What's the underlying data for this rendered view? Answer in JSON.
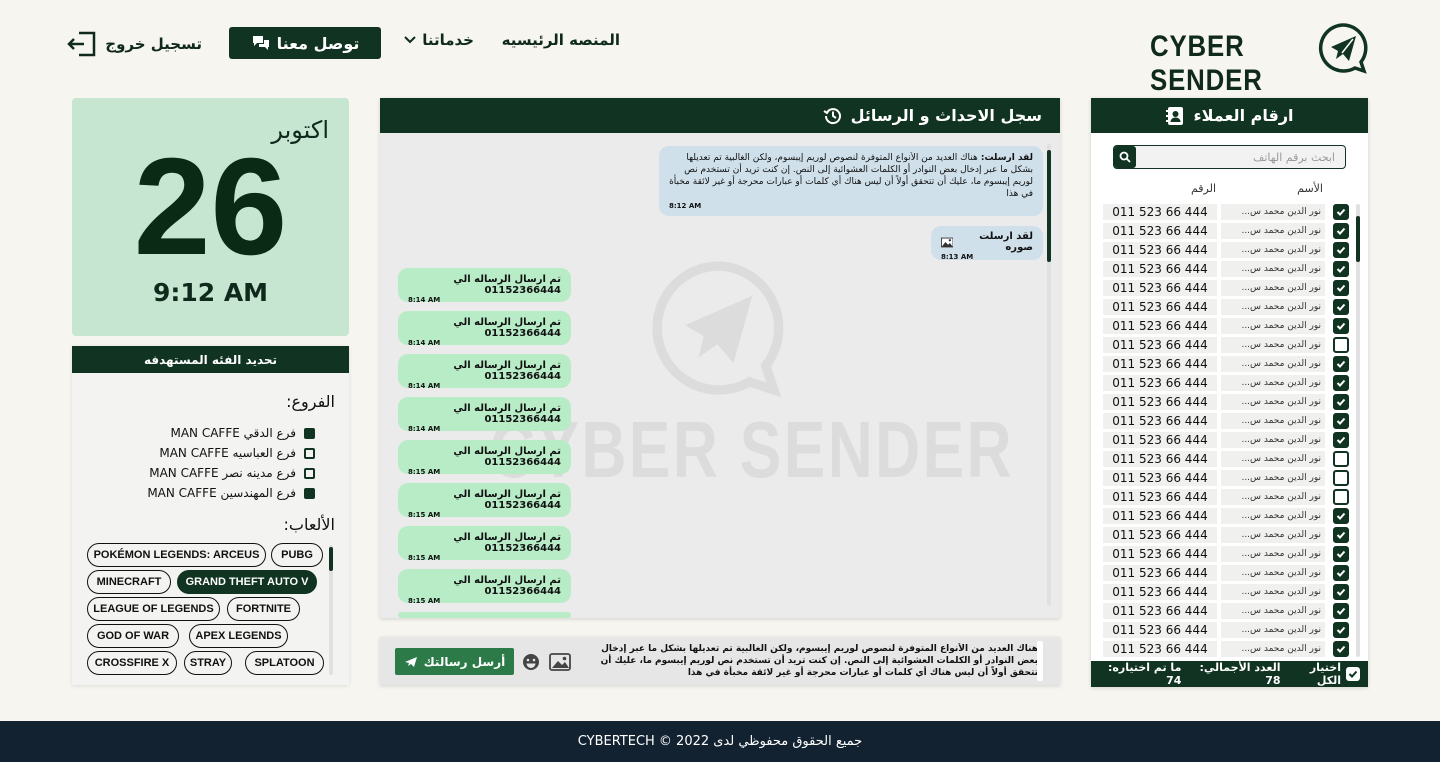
{
  "header": {
    "logo_text": "CYBER SENDER",
    "nav_home": "المنصه الرئيسيه",
    "nav_services": "خدماتنا",
    "contact_button": "توصل معنا",
    "logout": "تسجيل خروج"
  },
  "customers": {
    "title": "ارقام العملاء",
    "search_placeholder": "ابحث برقم الهاتف",
    "col_name": "الأسم",
    "col_number": "الرقم",
    "rows": [
      {
        "name": "نور الدين محمد س...",
        "number": "011 523 66 444",
        "checked": true
      },
      {
        "name": "نور الدين محمد س...",
        "number": "011 523 66 444",
        "checked": true
      },
      {
        "name": "نور الدين محمد س...",
        "number": "011 523 66 444",
        "checked": true
      },
      {
        "name": "نور الدين محمد س...",
        "number": "011 523 66 444",
        "checked": true
      },
      {
        "name": "نور الدين محمد س...",
        "number": "011 523 66 444",
        "checked": true
      },
      {
        "name": "نور الدين محمد س...",
        "number": "011 523 66 444",
        "checked": true
      },
      {
        "name": "نور الدين محمد س...",
        "number": "011 523 66 444",
        "checked": true
      },
      {
        "name": "نور الدين محمد س...",
        "number": "011 523 66 444",
        "checked": false
      },
      {
        "name": "نور الدين محمد س...",
        "number": "011 523 66 444",
        "checked": true
      },
      {
        "name": "نور الدين محمد س...",
        "number": "011 523 66 444",
        "checked": true
      },
      {
        "name": "نور الدين محمد س...",
        "number": "011 523 66 444",
        "checked": true
      },
      {
        "name": "نور الدين محمد س...",
        "number": "011 523 66 444",
        "checked": true
      },
      {
        "name": "نور الدين محمد س...",
        "number": "011 523 66 444",
        "checked": true
      },
      {
        "name": "نور الدين محمد س...",
        "number": "011 523 66 444",
        "checked": false
      },
      {
        "name": "نور الدين محمد س...",
        "number": "011 523 66 444",
        "checked": false
      },
      {
        "name": "نور الدين محمد س...",
        "number": "011 523 66 444",
        "checked": false
      },
      {
        "name": "نور الدين محمد س...",
        "number": "011 523 66 444",
        "checked": true
      },
      {
        "name": "نور الدين محمد س...",
        "number": "011 523 66 444",
        "checked": true
      },
      {
        "name": "نور الدين محمد س...",
        "number": "011 523 66 444",
        "checked": true
      },
      {
        "name": "نور الدين محمد س...",
        "number": "011 523 66 444",
        "checked": true
      },
      {
        "name": "نور الدين محمد س...",
        "number": "011 523 66 444",
        "checked": true
      },
      {
        "name": "نور الدين محمد س...",
        "number": "011 523 66 444",
        "checked": true
      },
      {
        "name": "نور الدين محمد س...",
        "number": "011 523 66 444",
        "checked": true
      },
      {
        "name": "نور الدين محمد س...",
        "number": "011 523 66 444",
        "checked": true
      }
    ],
    "select_all": "اختيار الكل",
    "total_label": "العدد الأجمالي: 78",
    "selected_label": "ما تم اختياره: 74"
  },
  "log": {
    "title": "سجل الاحداث و الرسائل",
    "incoming": [
      {
        "prefix": "لقد ارسلت:",
        "text": "هناك العديد من الأنواع المتوفرة لنصوص لوريم إيبسوم، ولكن الغالبية تم تعديلها بشكل ما عبر إدخال بعض النوادر أو الكلمات العشوائية إلى النص. إن كنت تريد أن تستخدم نص لوريم إيبسوم ما، عليك أن تتحقق أولاً أن ليس هناك أي كلمات أو عبارات محرجة أو غير لائقة مخبأة في هذا",
        "time": "8:12 AM"
      },
      {
        "prefix": "",
        "text": "لقد ارسلت صوره",
        "time": "8:13 AM"
      }
    ],
    "outgoing": [
      {
        "text": "تم ارسال الرساله الي 01152366444",
        "time": "8:14 AM"
      },
      {
        "text": "تم ارسال الرساله الي 01152366444",
        "time": "8:14 AM"
      },
      {
        "text": "تم ارسال الرساله الي 01152366444",
        "time": "8:14 AM"
      },
      {
        "text": "تم ارسال الرساله الي 01152366444",
        "time": "8:14 AM"
      },
      {
        "text": "تم ارسال الرساله الي 01152366444",
        "time": "8:15 AM"
      },
      {
        "text": "تم ارسال الرساله الي 01152366444",
        "time": "8:15 AM"
      },
      {
        "text": "تم ارسال الرساله الي 01152366444",
        "time": "8:15 AM"
      },
      {
        "text": "تم ارسال الرساله الي 01152366444",
        "time": "8:15 AM"
      }
    ],
    "watermark": "CYBER SENDER"
  },
  "composer": {
    "message": "هناك العديد من الأنواع المتوفرة لنصوص لوريم إيبسوم، ولكن الغالبية تم تعديلها بشكل ما عبر إدخال بعض النوادر أو الكلمات العشوائية إلى النص. إن كنت تريد أن تستخدم نص لوريم إيبسوم ما، عليك أن تتحقق أولاً أن ليس هناك أي كلمات أو عبارات محرجة أو غير لائقة مخبأة في هذا",
    "send_button": "أرسل رسالتك"
  },
  "calendar": {
    "month": "اكتوبر",
    "day": "26",
    "time": "9:12 AM"
  },
  "filter": {
    "title": "تحديد الفئه المستهدفه",
    "branches_title": "الفروع:",
    "branches": [
      {
        "label": "فرع الدقي MAN CAFFE",
        "checked": true
      },
      {
        "label": "فرع العباسيه MAN CAFFE",
        "checked": false
      },
      {
        "label": "فرع مدينه نصر MAN CAFFE",
        "checked": false
      },
      {
        "label": "فرع المهندسين MAN CAFFE",
        "checked": true
      }
    ],
    "games_title": "الألعاب:",
    "games": [
      {
        "label": "PUBG",
        "selected": false
      },
      {
        "label": "POKÉMON LEGENDS: ARCEUS",
        "selected": false
      },
      {
        "label": "GRAND THEFT AUTO V",
        "selected": true
      },
      {
        "label": "MINECRAFT",
        "selected": false
      },
      {
        "label": "FORTNITE",
        "selected": false
      },
      {
        "label": "LEAGUE OF LEGENDS",
        "selected": false
      },
      {
        "label": "APEX LEGENDS",
        "selected": false
      },
      {
        "label": "GOD OF WAR",
        "selected": false
      },
      {
        "label": "SPLATOON",
        "selected": false
      },
      {
        "label": "STRAY",
        "selected": false
      },
      {
        "label": "CROSSFIRE X",
        "selected": false
      }
    ]
  },
  "footer": {
    "copyright": "جميع الحقوق محفوظي لدى CYBERTECH © 2022"
  },
  "colors": {
    "brand_dark": "#103322",
    "accent_green": "#2b7a48",
    "bubble_out": "#b8ecc7",
    "bubble_in": "#cfe0ea",
    "calendar_bg": "#c7e6d1",
    "footer_bg": "#122230"
  }
}
